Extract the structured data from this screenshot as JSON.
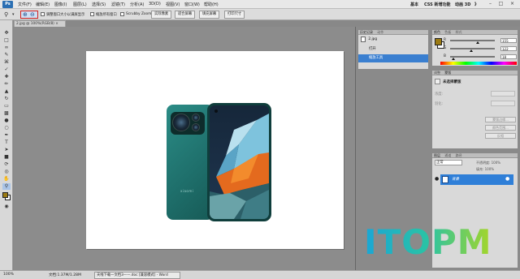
{
  "menubar": {
    "logo": "Ps",
    "items": [
      "文件(F)",
      "编辑(E)",
      "图像(I)",
      "图层(L)",
      "选择(S)",
      "滤镜(T)",
      "分析(A)",
      "3D(D)",
      "视图(V)",
      "窗口(W)",
      "帮助(H)"
    ],
    "workspaces": [
      "基本",
      "CSS 新增功能",
      "动画 3D",
      "》"
    ],
    "window_buttons": [
      "–",
      "□",
      "×"
    ]
  },
  "optionsbar": {
    "resize_windows_label": "调整窗口大小以满屏显示",
    "zoom_all_label": "缩放所有窗口",
    "scrubby_label": "Scrubby Zoom",
    "buttons": [
      "实际像素",
      "适合屏幕",
      "填充屏幕",
      "打印尺寸"
    ]
  },
  "document": {
    "tab_title": "2.jpg @ 100%(RGB/8) ×",
    "phone_brand": "xiaomi"
  },
  "history_panel": {
    "tabs": [
      "历史记录",
      "动作"
    ],
    "snapshot": "2.jpg",
    "items": [
      "打开",
      "缩放工具"
    ],
    "selected_index": 1
  },
  "color_panel": {
    "tabs": [
      "颜色",
      "色板",
      "样式"
    ],
    "channels": [
      {
        "label": "R",
        "value": "155",
        "fraction": 0.61
      },
      {
        "label": "G",
        "value": "122",
        "fraction": 0.48
      },
      {
        "label": "B",
        "value": "18",
        "fraction": 0.07
      }
    ],
    "foreground": "#9b7a12"
  },
  "masks_panel": {
    "tabs": [
      "调整",
      "蒙版"
    ],
    "title": "未选择蒙版",
    "field_labels": [
      "浓度:",
      "羽化:"
    ],
    "buttons": [
      "蒙版边缘...",
      "颜色范围...",
      "反相"
    ]
  },
  "layers_panel": {
    "tabs": [
      "图层",
      "通道",
      "路径"
    ],
    "blend_mode": "正常",
    "opacity": "不透明度: 100%",
    "fill": "填充: 100%",
    "layer_name": "背景"
  },
  "statusbar": {
    "zoom": "100%",
    "doc_size": "文档:1.37M/1.28M",
    "taskbar_item": "天线下载一文档3——.doc [兼容模式] - Word"
  },
  "watermark": {
    "text": "ITOPM",
    "colors": [
      "#1aa6d6",
      "#16b3c8",
      "#2ac3a4",
      "#7fcf3c",
      "#a8d626"
    ]
  }
}
